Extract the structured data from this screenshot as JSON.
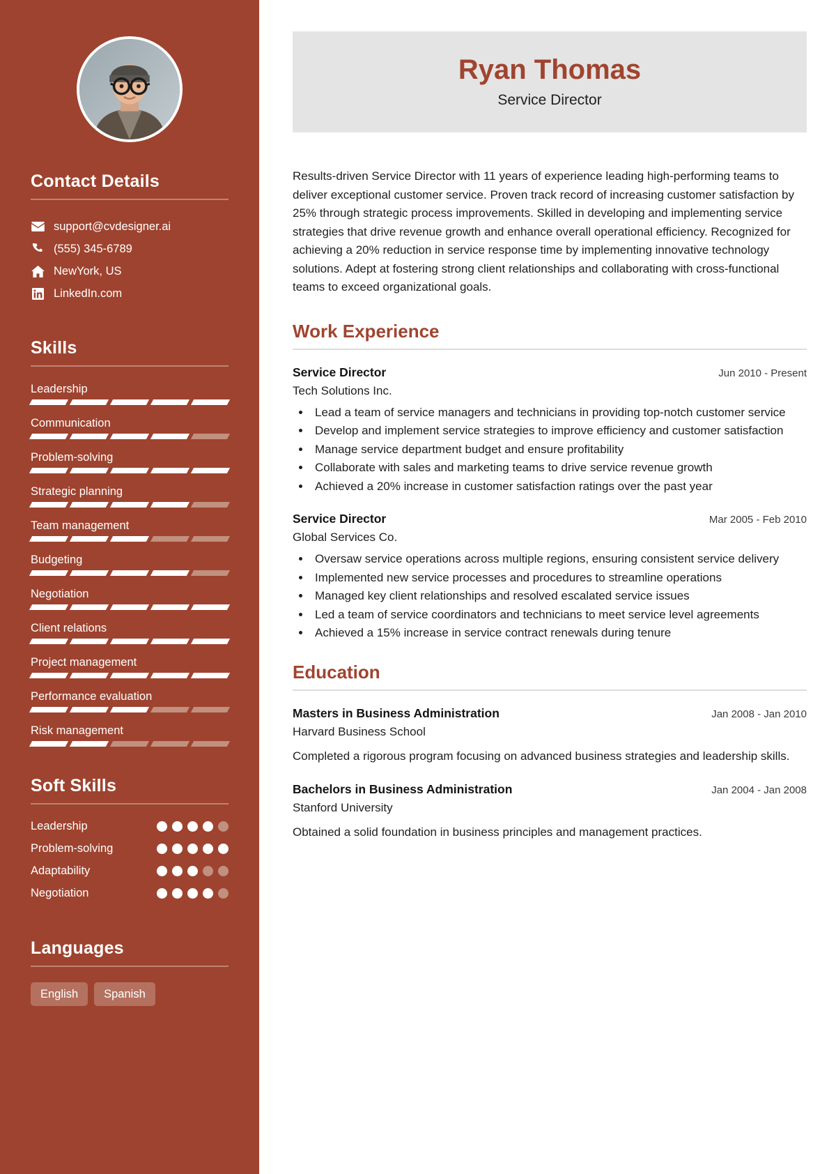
{
  "theme": {
    "sidebar_bg": "#9e432f",
    "accent": "#a0442f",
    "name_card_bg": "#e4e4e4",
    "muted_bar": "#c1907f",
    "tag_bg": "#b4715f"
  },
  "header": {
    "name": "Ryan Thomas",
    "role": "Service Director"
  },
  "summary": "Results-driven Service Director with 11 years of experience leading high-performing teams to deliver exceptional customer service. Proven track record of increasing customer satisfaction by 25% through strategic process improvements. Skilled in developing and implementing service strategies that drive revenue growth and enhance overall operational efficiency. Recognized for achieving a 20% reduction in service response time by implementing innovative technology solutions. Adept at fostering strong client relationships and collaborating with cross-functional teams to exceed organizational goals.",
  "sidebar": {
    "contact": {
      "title": "Contact Details",
      "items": [
        {
          "icon": "envelope-icon",
          "text": "support@cvdesigner.ai"
        },
        {
          "icon": "phone-icon",
          "text": "(555) 345-6789"
        },
        {
          "icon": "home-icon",
          "text": "NewYork, US"
        },
        {
          "icon": "linkedin-icon",
          "text": "LinkedIn.com"
        }
      ]
    },
    "skills": {
      "title": "Skills",
      "max": 5,
      "items": [
        {
          "label": "Leadership",
          "level": 5
        },
        {
          "label": "Communication",
          "level": 4
        },
        {
          "label": "Problem-solving",
          "level": 5
        },
        {
          "label": "Strategic planning",
          "level": 4
        },
        {
          "label": "Team management",
          "level": 3
        },
        {
          "label": "Budgeting",
          "level": 4
        },
        {
          "label": "Negotiation",
          "level": 5
        },
        {
          "label": "Client relations",
          "level": 5
        },
        {
          "label": "Project management",
          "level": 5
        },
        {
          "label": "Performance evaluation",
          "level": 3
        },
        {
          "label": "Risk management",
          "level": 2
        }
      ]
    },
    "soft_skills": {
      "title": "Soft Skills",
      "max": 5,
      "items": [
        {
          "label": "Leadership",
          "level": 4
        },
        {
          "label": "Problem-solving",
          "level": 5
        },
        {
          "label": "Adaptability",
          "level": 3
        },
        {
          "label": "Negotiation",
          "level": 4
        }
      ]
    },
    "languages": {
      "title": "Languages",
      "items": [
        "English",
        "Spanish"
      ]
    }
  },
  "main": {
    "work": {
      "title": "Work Experience",
      "entries": [
        {
          "title": "Service Director",
          "date": "Jun 2010 - Present",
          "org": "Tech Solutions Inc.",
          "bullets": [
            "Lead a team of service managers and technicians in providing top-notch customer service",
            "Develop and implement service strategies to improve efficiency and customer satisfaction",
            "Manage service department budget and ensure profitability",
            "Collaborate with sales and marketing teams to drive service revenue growth",
            "Achieved a 20% increase in customer satisfaction ratings over the past year"
          ]
        },
        {
          "title": "Service Director",
          "date": "Mar 2005 - Feb 2010",
          "org": "Global Services Co.",
          "bullets": [
            "Oversaw service operations across multiple regions, ensuring consistent service delivery",
            "Implemented new service processes and procedures to streamline operations",
            "Managed key client relationships and resolved escalated service issues",
            "Led a team of service coordinators and technicians to meet service level agreements",
            "Achieved a 15% increase in service contract renewals during tenure"
          ]
        }
      ]
    },
    "education": {
      "title": "Education",
      "entries": [
        {
          "title": "Masters in Business Administration",
          "date": "Jan 2008 - Jan 2010",
          "org": "Harvard Business School",
          "desc": "Completed a rigorous program focusing on advanced business strategies and leadership skills."
        },
        {
          "title": "Bachelors in Business Administration",
          "date": "Jan 2004 - Jan 2008",
          "org": "Stanford University",
          "desc": "Obtained a solid foundation in business principles and management practices."
        }
      ]
    }
  }
}
